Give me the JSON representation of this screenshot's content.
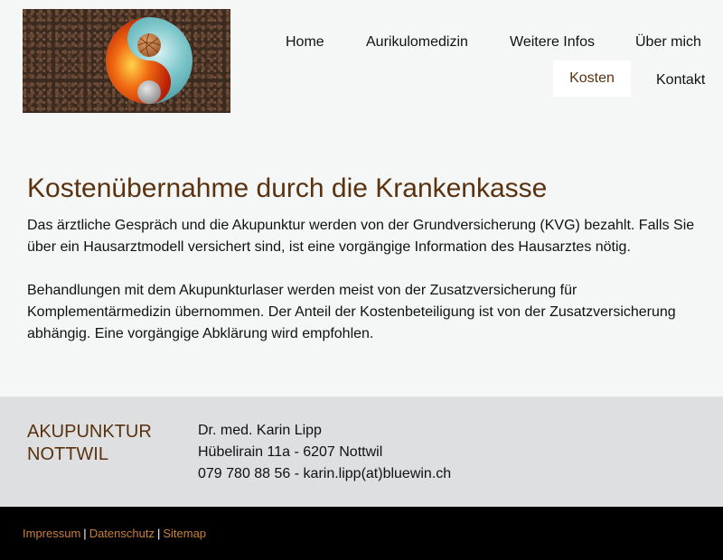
{
  "nav": {
    "items": [
      {
        "label": "Home"
      },
      {
        "label": "Aurikulomedizin"
      },
      {
        "label": "Weitere Infos"
      },
      {
        "label": "Über mich"
      },
      {
        "label": "Kosten",
        "active": true
      },
      {
        "label": "Kontakt"
      }
    ]
  },
  "main": {
    "title": "Kostenübernahme durch die Krankenkasse",
    "paragraphs": [
      "Das ärztliche Gespräch und die Akupunktur werden von der Grundversicherung (KVG) bezahlt. Falls Sie über ein Hausarztmodell versichert sind, ist eine vorgängige Information des Hausarztes nötig.",
      "Behandlungen mit dem Akupunkturlaser werden meist von der Zusatzversicherung für Komplementärmedizin übernommen. Der Anteil der Kostenbeteiligung ist von der Zusatzversicherung abhängig. Eine vorgängige Abklärung wird empfohlen."
    ]
  },
  "footer": {
    "brand_line1": "AKUPUNKTUR",
    "brand_line2": "NOTTWIL",
    "contact": {
      "name": "Dr. med. Karin Lipp",
      "address": "Hübelirain 11a - 6207 Nottwil",
      "phone_email": "079 780 88 56 - karin.lipp(at)bluewin.ch"
    },
    "legal": {
      "impressum": "Impressum",
      "datenschutz": "Datenschutz",
      "sitemap": "Sitemap",
      "separator": "|"
    }
  },
  "colors": {
    "accent": "#5a3210",
    "link": "#c9803a",
    "background": "#f5f7f6",
    "footer_band": "#dedfe0",
    "bottom_bar": "#000000"
  },
  "icons": {
    "logo": "yin-yang-fire-water-logo"
  }
}
